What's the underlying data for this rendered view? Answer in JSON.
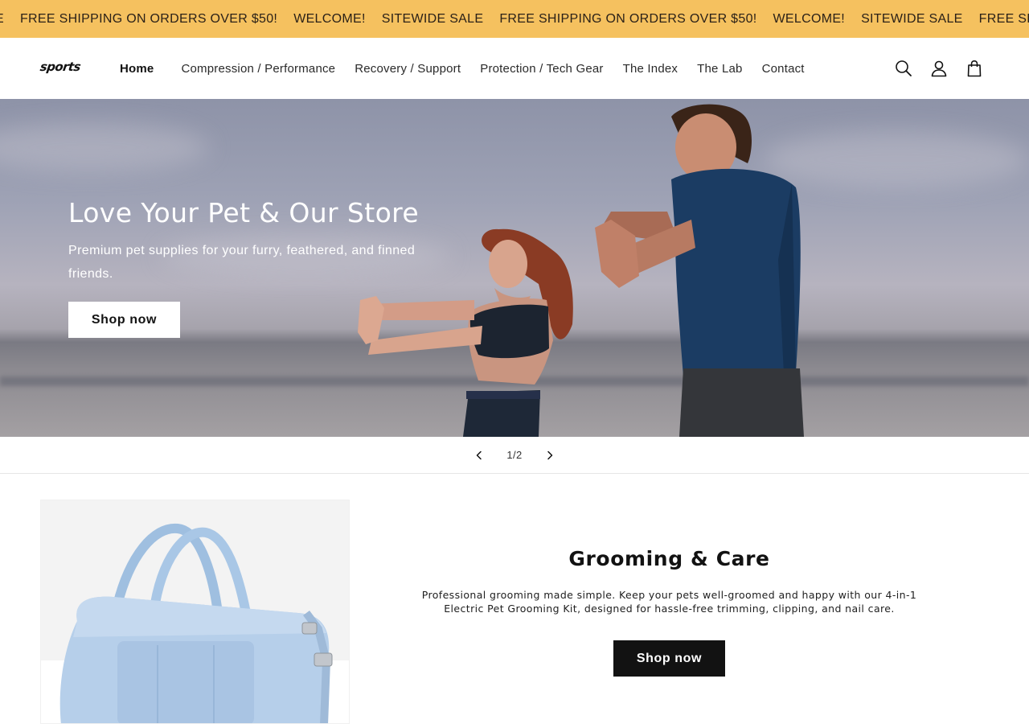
{
  "announcement": {
    "items": [
      "E",
      "FREE SHIPPING ON ORDERS OVER $50!",
      "WELCOME!",
      "SITEWIDE SALE",
      "FREE SHIPPING ON ORDERS OVER $50!",
      "WELCOME!",
      "SITEWIDE SALE",
      "FREE SHIPPING ON ORD"
    ],
    "background": "#f5c15f"
  },
  "header": {
    "logo": "sports",
    "nav": [
      {
        "label": "Home",
        "active": true
      },
      {
        "label": "Compression / Performance"
      },
      {
        "label": "Recovery / Support"
      },
      {
        "label": "Protection / Tech Gear"
      },
      {
        "label": "The Index"
      },
      {
        "label": "The Lab"
      },
      {
        "label": "Contact"
      }
    ],
    "icons": [
      "search-icon",
      "account-icon",
      "cart-icon"
    ]
  },
  "hero": {
    "title": "Love Your Pet & Our Store",
    "subtitle": "Premium pet supplies for your furry, feathered, and finned friends.",
    "button": "Shop now"
  },
  "slider": {
    "counter": "1/2"
  },
  "feature": {
    "title": "Grooming & Care",
    "text": "Professional grooming made simple. Keep your pets well-groomed and happy with our 4-in-1 Electric Pet Grooming Kit, designed for hassle-free trimming, clipping, and nail care.",
    "button": "Shop now"
  }
}
